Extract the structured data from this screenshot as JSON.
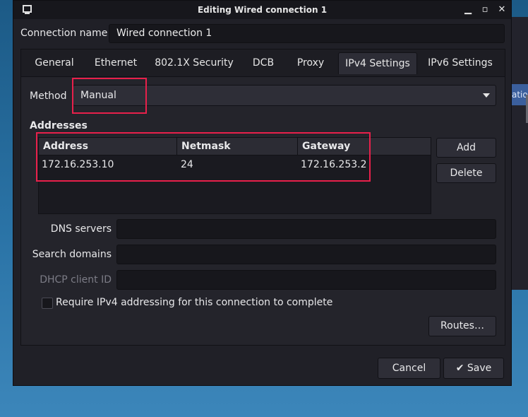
{
  "window": {
    "title": "Editing Wired connection 1",
    "controls": {
      "minimize": "▁",
      "maximize": "▫",
      "close": "✕"
    }
  },
  "connection": {
    "name_label": "Connection name",
    "name_value": "Wired connection 1"
  },
  "tabs": [
    {
      "label": "General"
    },
    {
      "label": "Ethernet"
    },
    {
      "label": "802.1X Security"
    },
    {
      "label": "DCB"
    },
    {
      "label": "Proxy"
    },
    {
      "label": "IPv4 Settings",
      "active": true
    },
    {
      "label": "IPv6 Settings"
    }
  ],
  "ipv4": {
    "method_label": "Method",
    "method_value": "Manual",
    "addresses_label": "Addresses",
    "columns": [
      "Address",
      "Netmask",
      "Gateway"
    ],
    "rows": [
      {
        "address": "172.16.253.10",
        "netmask": "24",
        "gateway": "172.16.253.2"
      }
    ],
    "add_label": "Add",
    "delete_label": "Delete",
    "dns_label": "DNS servers",
    "search_label": "Search domains",
    "dhcp_label": "DHCP client ID",
    "dns_value": "",
    "search_value": "",
    "dhcp_value": "",
    "require_label": "Require IPv4 addressing for this connection to complete",
    "require_checked": false,
    "routes_label": "Routes…"
  },
  "footer": {
    "cancel_label": "Cancel",
    "save_label": "Save",
    "save_icon": "✔"
  },
  "background_window": {
    "tab_label": "ation"
  },
  "colors": {
    "highlight": "#e8204b",
    "dialog_bg": "#202027",
    "desktop": "#2a73a6"
  }
}
